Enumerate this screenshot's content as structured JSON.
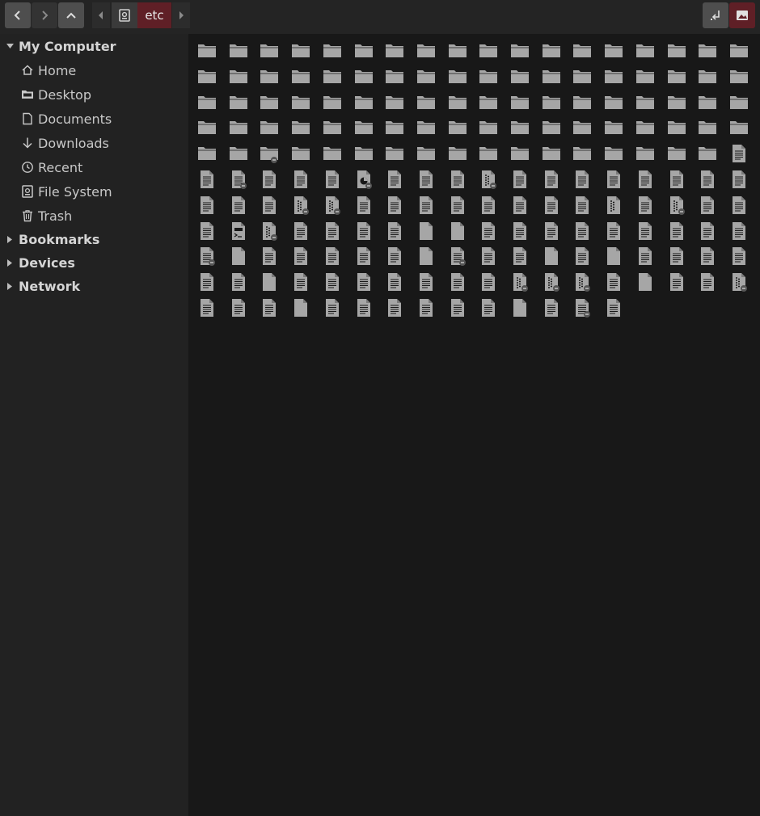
{
  "toolbar": {
    "back_button": "back",
    "forward_button": "forward",
    "up_button": "up",
    "breadcrumb": {
      "left_arrow": "breadcrumb-left",
      "root_icon": "filesystem-drive-icon",
      "current": "etc",
      "right_arrow": "breadcrumb-right"
    },
    "colors": {
      "bg": "#242424",
      "button": "#4a4a4a",
      "accent": "#5f1f26"
    }
  },
  "sidebar": {
    "sections": [
      {
        "label": "My Computer",
        "expanded": true,
        "items": [
          {
            "label": "Home",
            "icon": "home-icon"
          },
          {
            "label": "Desktop",
            "icon": "desktop-folder-icon"
          },
          {
            "label": "Documents",
            "icon": "document-icon"
          },
          {
            "label": "Downloads",
            "icon": "download-icon"
          },
          {
            "label": "Recent",
            "icon": "clock-icon"
          },
          {
            "label": "File System",
            "icon": "drive-icon"
          },
          {
            "label": "Trash",
            "icon": "trash-icon"
          }
        ]
      },
      {
        "label": "Bookmarks",
        "expanded": false,
        "items": []
      },
      {
        "label": "Devices",
        "expanded": false,
        "items": []
      },
      {
        "label": "Network",
        "expanded": false,
        "items": []
      }
    ]
  },
  "content": {
    "icons": [
      "folder",
      "folder",
      "folder",
      "folder",
      "folder",
      "folder",
      "folder",
      "folder",
      "folder",
      "folder",
      "folder",
      "folder",
      "folder",
      "folder",
      "folder",
      "folder",
      "folder",
      "folder",
      "folder",
      "folder",
      "folder",
      "folder",
      "folder",
      "folder",
      "folder",
      "folder",
      "folder",
      "folder",
      "folder",
      "folder",
      "folder",
      "folder",
      "folder",
      "folder",
      "folder",
      "folder",
      "folder",
      "folder",
      "folder",
      "folder",
      "folder",
      "folder",
      "folder",
      "folder",
      "folder",
      "folder",
      "folder",
      "folder",
      "folder",
      "folder",
      "folder",
      "folder",
      "folder",
      "folder",
      "folder",
      "folder",
      "folder",
      "folder",
      "folder",
      "folder",
      "folder",
      "folder",
      "folder",
      "folder",
      "folder",
      "folder",
      "folder",
      "folder",
      "folder",
      "folder",
      "folder",
      "folder",
      "folder",
      "folder",
      "folder-link",
      "folder",
      "folder",
      "folder",
      "folder",
      "folder",
      "folder",
      "folder",
      "folder",
      "folder",
      "folder",
      "folder",
      "folder",
      "folder",
      "folder",
      "text",
      "text",
      "text-link",
      "text",
      "text",
      "text",
      "image-link",
      "text",
      "text",
      "text",
      "dots-link",
      "text",
      "text",
      "text",
      "text",
      "text",
      "text",
      "text",
      "text",
      "text",
      "text",
      "text",
      "dots-link",
      "dots-link",
      "text",
      "text",
      "text",
      "text",
      "text",
      "text",
      "text",
      "text",
      "dots",
      "text",
      "dots-link",
      "text",
      "text",
      "text",
      "script",
      "dots-link",
      "text",
      "text",
      "text",
      "text",
      "blank",
      "blank",
      "text",
      "text",
      "text",
      "text",
      "text",
      "text",
      "text",
      "text",
      "text",
      "text-link",
      "blank",
      "text",
      "text",
      "text",
      "text",
      "text",
      "blank",
      "text-link",
      "text",
      "text",
      "blank",
      "text",
      "blank",
      "text",
      "text",
      "text",
      "text",
      "text",
      "text",
      "blank",
      "text",
      "text",
      "text",
      "text",
      "text",
      "text",
      "text",
      "dots-link",
      "dots-link",
      "dots-link",
      "text",
      "blank",
      "text",
      "text",
      "dots-link",
      "text",
      "text",
      "text",
      "blank",
      "text",
      "text",
      "text",
      "text",
      "text",
      "text",
      "blank",
      "text",
      "text-link",
      "text"
    ]
  }
}
